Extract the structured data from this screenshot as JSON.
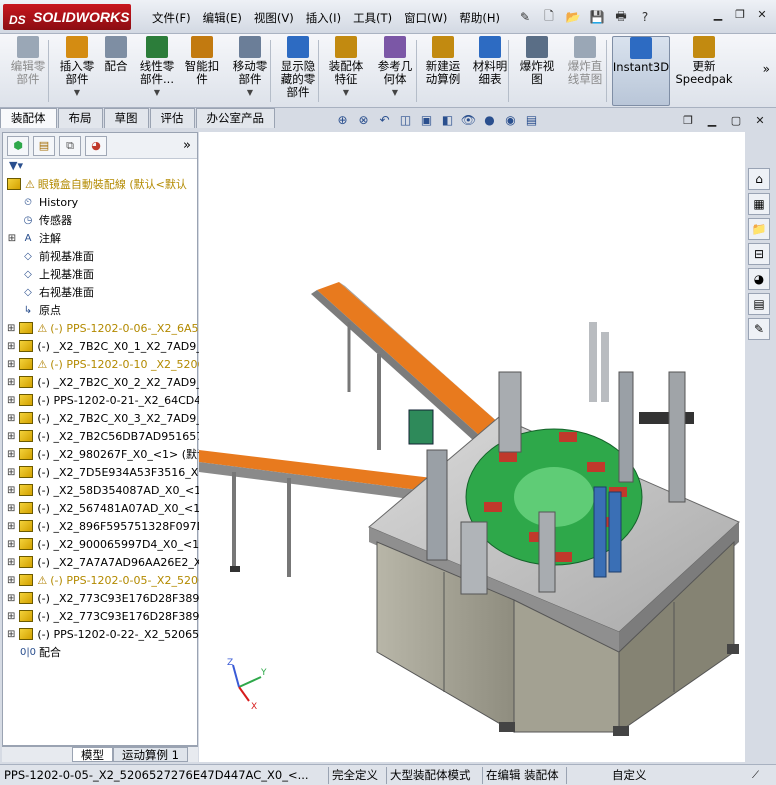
{
  "app": {
    "name": "SOLIDWORKS",
    "brand_prefix": "DS"
  },
  "menu": [
    "文件(F)",
    "编辑(E)",
    "视图(V)",
    "插入(I)",
    "工具(T)",
    "窗口(W)",
    "帮助(H)"
  ],
  "ribbon": [
    {
      "label": "编辑零\n部件",
      "icon": "edit-component-icon",
      "enabled": false
    },
    {
      "label": "插入零\n部件",
      "icon": "insert-component-icon",
      "enabled": true,
      "dropdown": true
    },
    {
      "label": "配合",
      "icon": "mate-icon",
      "enabled": true
    },
    {
      "label": "线性零\n部件...",
      "icon": "linear-pattern-icon",
      "enabled": true,
      "dropdown": true
    },
    {
      "label": "智能扣\n件",
      "icon": "smart-fastener-icon",
      "enabled": true
    },
    {
      "label": "移动零\n部件",
      "icon": "move-component-icon",
      "enabled": true,
      "dropdown": true
    },
    {
      "label": "显示隐\n藏的零\n部件",
      "icon": "show-hidden-icon",
      "enabled": true
    },
    {
      "label": "装配体\n特征",
      "icon": "assembly-feature-icon",
      "enabled": true,
      "dropdown": true
    },
    {
      "label": "参考几\n何体",
      "icon": "reference-geometry-icon",
      "enabled": true,
      "dropdown": true
    },
    {
      "label": "新建运\n动算例",
      "icon": "motion-study-icon",
      "enabled": true
    },
    {
      "label": "材料明\n细表",
      "icon": "bom-icon",
      "enabled": true
    },
    {
      "label": "爆炸视\n图",
      "icon": "exploded-view-icon",
      "enabled": true
    },
    {
      "label": "爆炸直\n线草图",
      "icon": "explode-line-icon",
      "enabled": false
    },
    {
      "label": "Instant3D",
      "icon": "instant3d-icon",
      "enabled": true
    },
    {
      "label": "更新\nSpeedpak",
      "icon": "speedpak-icon",
      "enabled": true
    }
  ],
  "command_tabs": [
    "装配体",
    "布局",
    "草图",
    "评估",
    "办公室产品"
  ],
  "panel_tab_icons": [
    "feature-manager-icon",
    "property-manager-icon",
    "configuration-manager-icon",
    "display-manager-icon"
  ],
  "tree": {
    "root": "眼镜盒自動裝配線 (默认<默认",
    "items": [
      {
        "label": "History",
        "icon": "history-icon",
        "expand": false,
        "style": "normal"
      },
      {
        "label": "传感器",
        "icon": "sensor-icon",
        "expand": false,
        "style": "normal"
      },
      {
        "label": "注解",
        "icon": "annotation-icon",
        "expand": true,
        "style": "normal"
      },
      {
        "label": "前视基准面",
        "icon": "plane-icon",
        "expand": false,
        "style": "normal"
      },
      {
        "label": "上视基准面",
        "icon": "plane-icon",
        "expand": false,
        "style": "normal"
      },
      {
        "label": "右视基准面",
        "icon": "plane-icon",
        "expand": false,
        "style": "normal"
      },
      {
        "label": "原点",
        "icon": "origin-icon",
        "expand": false,
        "style": "normal"
      },
      {
        "label": "(-) PPS-1202-0-06-_X2_6A5E",
        "icon": "assembly-warn-icon",
        "expand": true,
        "style": "warn"
      },
      {
        "label": "(-) _X2_7B2C_X0_1_X2_7AD9_",
        "icon": "assembly-icon",
        "expand": true,
        "style": "normal"
      },
      {
        "label": "(-) PPS-1202-0-10 _X2_5206",
        "icon": "assembly-warn-icon",
        "expand": true,
        "style": "warn"
      },
      {
        "label": "(-) _X2_7B2C_X0_2_X2_7AD9_",
        "icon": "assembly-icon",
        "expand": true,
        "style": "normal"
      },
      {
        "label": "(-) PPS-1202-0-21-_X2_64CD4F",
        "icon": "assembly-icon",
        "expand": true,
        "style": "normal"
      },
      {
        "label": "(-) _X2_7B2C_X0_3_X2_7AD9_",
        "icon": "assembly-icon",
        "expand": true,
        "style": "normal"
      },
      {
        "label": "(-) _X2_7B2C56DB7AD951657D",
        "icon": "assembly-icon",
        "expand": true,
        "style": "normal"
      },
      {
        "label": "(-) _X2_980267F_X0_<1> (默认",
        "icon": "assembly-icon",
        "expand": true,
        "style": "normal"
      },
      {
        "label": "(-) _X2_7D5E934A53F3516_X0",
        "icon": "assembly-icon",
        "expand": true,
        "style": "normal"
      },
      {
        "label": "(-) _X2_58D354087AD_X0_<1>",
        "icon": "assembly-icon",
        "expand": true,
        "style": "normal"
      },
      {
        "label": "(-) _X2_567481A07AD_X0_<1>",
        "icon": "assembly-icon",
        "expand": true,
        "style": "normal"
      },
      {
        "label": "(-) _X2_896F595751328F097D4",
        "icon": "assembly-icon",
        "expand": true,
        "style": "normal"
      },
      {
        "label": "(-) _X2_900065997D4_X0_<1>",
        "icon": "assembly-icon",
        "expand": true,
        "style": "normal"
      },
      {
        "label": "(-) _X2_7A7A7AD96AA26E2_X0",
        "icon": "assembly-icon",
        "expand": true,
        "style": "normal"
      },
      {
        "label": "(-) PPS-1202-0-05-_X2_5206",
        "icon": "assembly-warn-icon",
        "expand": true,
        "style": "warn"
      },
      {
        "label": "(-) _X2_773C93E176D28F38900",
        "icon": "assembly-icon",
        "expand": true,
        "style": "normal"
      },
      {
        "label": "(-) _X2_773C93E176D28F38900",
        "icon": "assembly-icon",
        "expand": true,
        "style": "normal"
      },
      {
        "label": "(-) PPS-1202-0-22-_X2_520652",
        "icon": "assembly-icon",
        "expand": true,
        "style": "normal"
      },
      {
        "label": "配合",
        "icon": "mates-folder-icon",
        "expand": false,
        "style": "normal"
      }
    ]
  },
  "bottom_tabs": [
    "模型",
    "运动算例 1"
  ],
  "status": {
    "component": "PPS-1202-0-05-_X2_5206527276E47D447AC_X0_<...",
    "definition": "完全定义",
    "mode": "大型装配体模式",
    "editing": "在编辑 装配体",
    "units": "自定义"
  },
  "triad_axes": [
    "Z",
    "Y",
    "X"
  ],
  "colors": {
    "accent": "#2a4f8e",
    "warning": "#e0a800",
    "brand": "#c8161e",
    "conveyor": "#e87a1e",
    "turntable": "#2ea84a"
  }
}
